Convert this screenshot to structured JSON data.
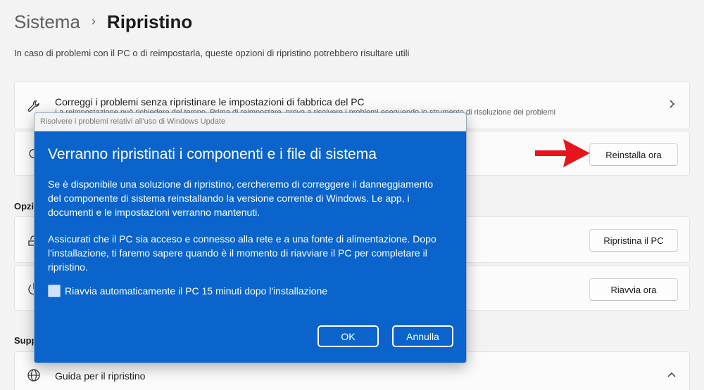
{
  "breadcrumb": {
    "parent": "Sistema",
    "separator": "›",
    "current": "Ripristino"
  },
  "description": "In caso di problemi con il PC o di reimpostarla, queste opzioni di ripristino potrebbero risultare utili",
  "troubleshoot_card": {
    "title": "Correggi i problemi senza ripristinare le impostazioni di fabbrica del PC",
    "subtitle": "La reimpostazione può richiedere del tempo. Prima di reimpostare, prova a risolvere i problemi eseguendo lo strumento di risoluzione dei problemi"
  },
  "reinstall_card": {
    "button": "Reinstalla ora"
  },
  "section_options": {
    "label": "Opzi"
  },
  "reset_card": {
    "button": "Ripristina il PC"
  },
  "advanced_card": {
    "button": "Riavvia ora"
  },
  "section_support": {
    "label": "Supp"
  },
  "help_card": {
    "title": "Guida per il ripristino"
  },
  "dialog": {
    "window_title": "Risolvere i problemi relativi all'uso di Windows Update",
    "heading": "Verranno ripristinati i componenti e i file di sistema",
    "paragraph1": "Se è disponibile una soluzione di ripristino, cercheremo di correggere il danneggiamento del componente di sistema reinstallando la versione corrente di Windows. Le app, i documenti e le impostazioni verranno mantenuti.",
    "paragraph2": "Assicurati che il PC sia acceso e connesso alla rete e a una fonte di alimentazione. Dopo l'installazione, ti faremo sapere quando è il momento di riavviare il PC per completare il ripristino.",
    "checkbox_label": "Riavvia automaticamente il PC 15 minuti dopo l'installazione",
    "checkbox_checked": false,
    "ok_button": "OK",
    "cancel_button": "Annulla",
    "accent_color": "#0a64cc"
  },
  "colors": {
    "arrow": "#e8141c",
    "background": "#f3f3f3"
  }
}
